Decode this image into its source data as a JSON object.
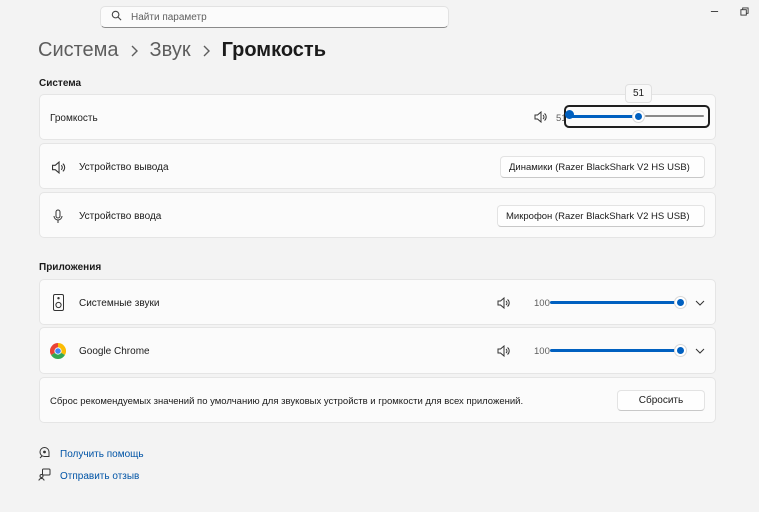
{
  "search": {
    "placeholder": "Найти параметр"
  },
  "breadcrumb": {
    "items": [
      "Система",
      "Звук",
      "Громкость"
    ]
  },
  "sections": {
    "system": "Система",
    "apps": "Приложения"
  },
  "volume": {
    "label": "Громкость",
    "value_text": "51",
    "tooltip": "51",
    "level_percent": 51
  },
  "output": {
    "label": "Устройство вывода",
    "selected": "Динамики (Razer BlackShark V2 HS USB)"
  },
  "input": {
    "label": "Устройство ввода",
    "selected": "Микрофон (Razer BlackShark V2 HS USB)"
  },
  "apps": [
    {
      "name": "Системные звуки",
      "volume_text": "100",
      "level_percent": 100
    },
    {
      "name": "Google Chrome",
      "volume_text": "100",
      "level_percent": 100
    }
  ],
  "reset": {
    "description": "Сброс рекомендуемых значений по умолчанию для звуковых устройств и громкости для всех приложений.",
    "button_label": "Сбросить"
  },
  "links": {
    "help": "Получить помощь",
    "feedback": "Отправить отзыв"
  },
  "colors": {
    "accent": "#0060c0",
    "link": "#0054a6",
    "background": "#f3f3f3",
    "card": "#fbfbfb"
  }
}
